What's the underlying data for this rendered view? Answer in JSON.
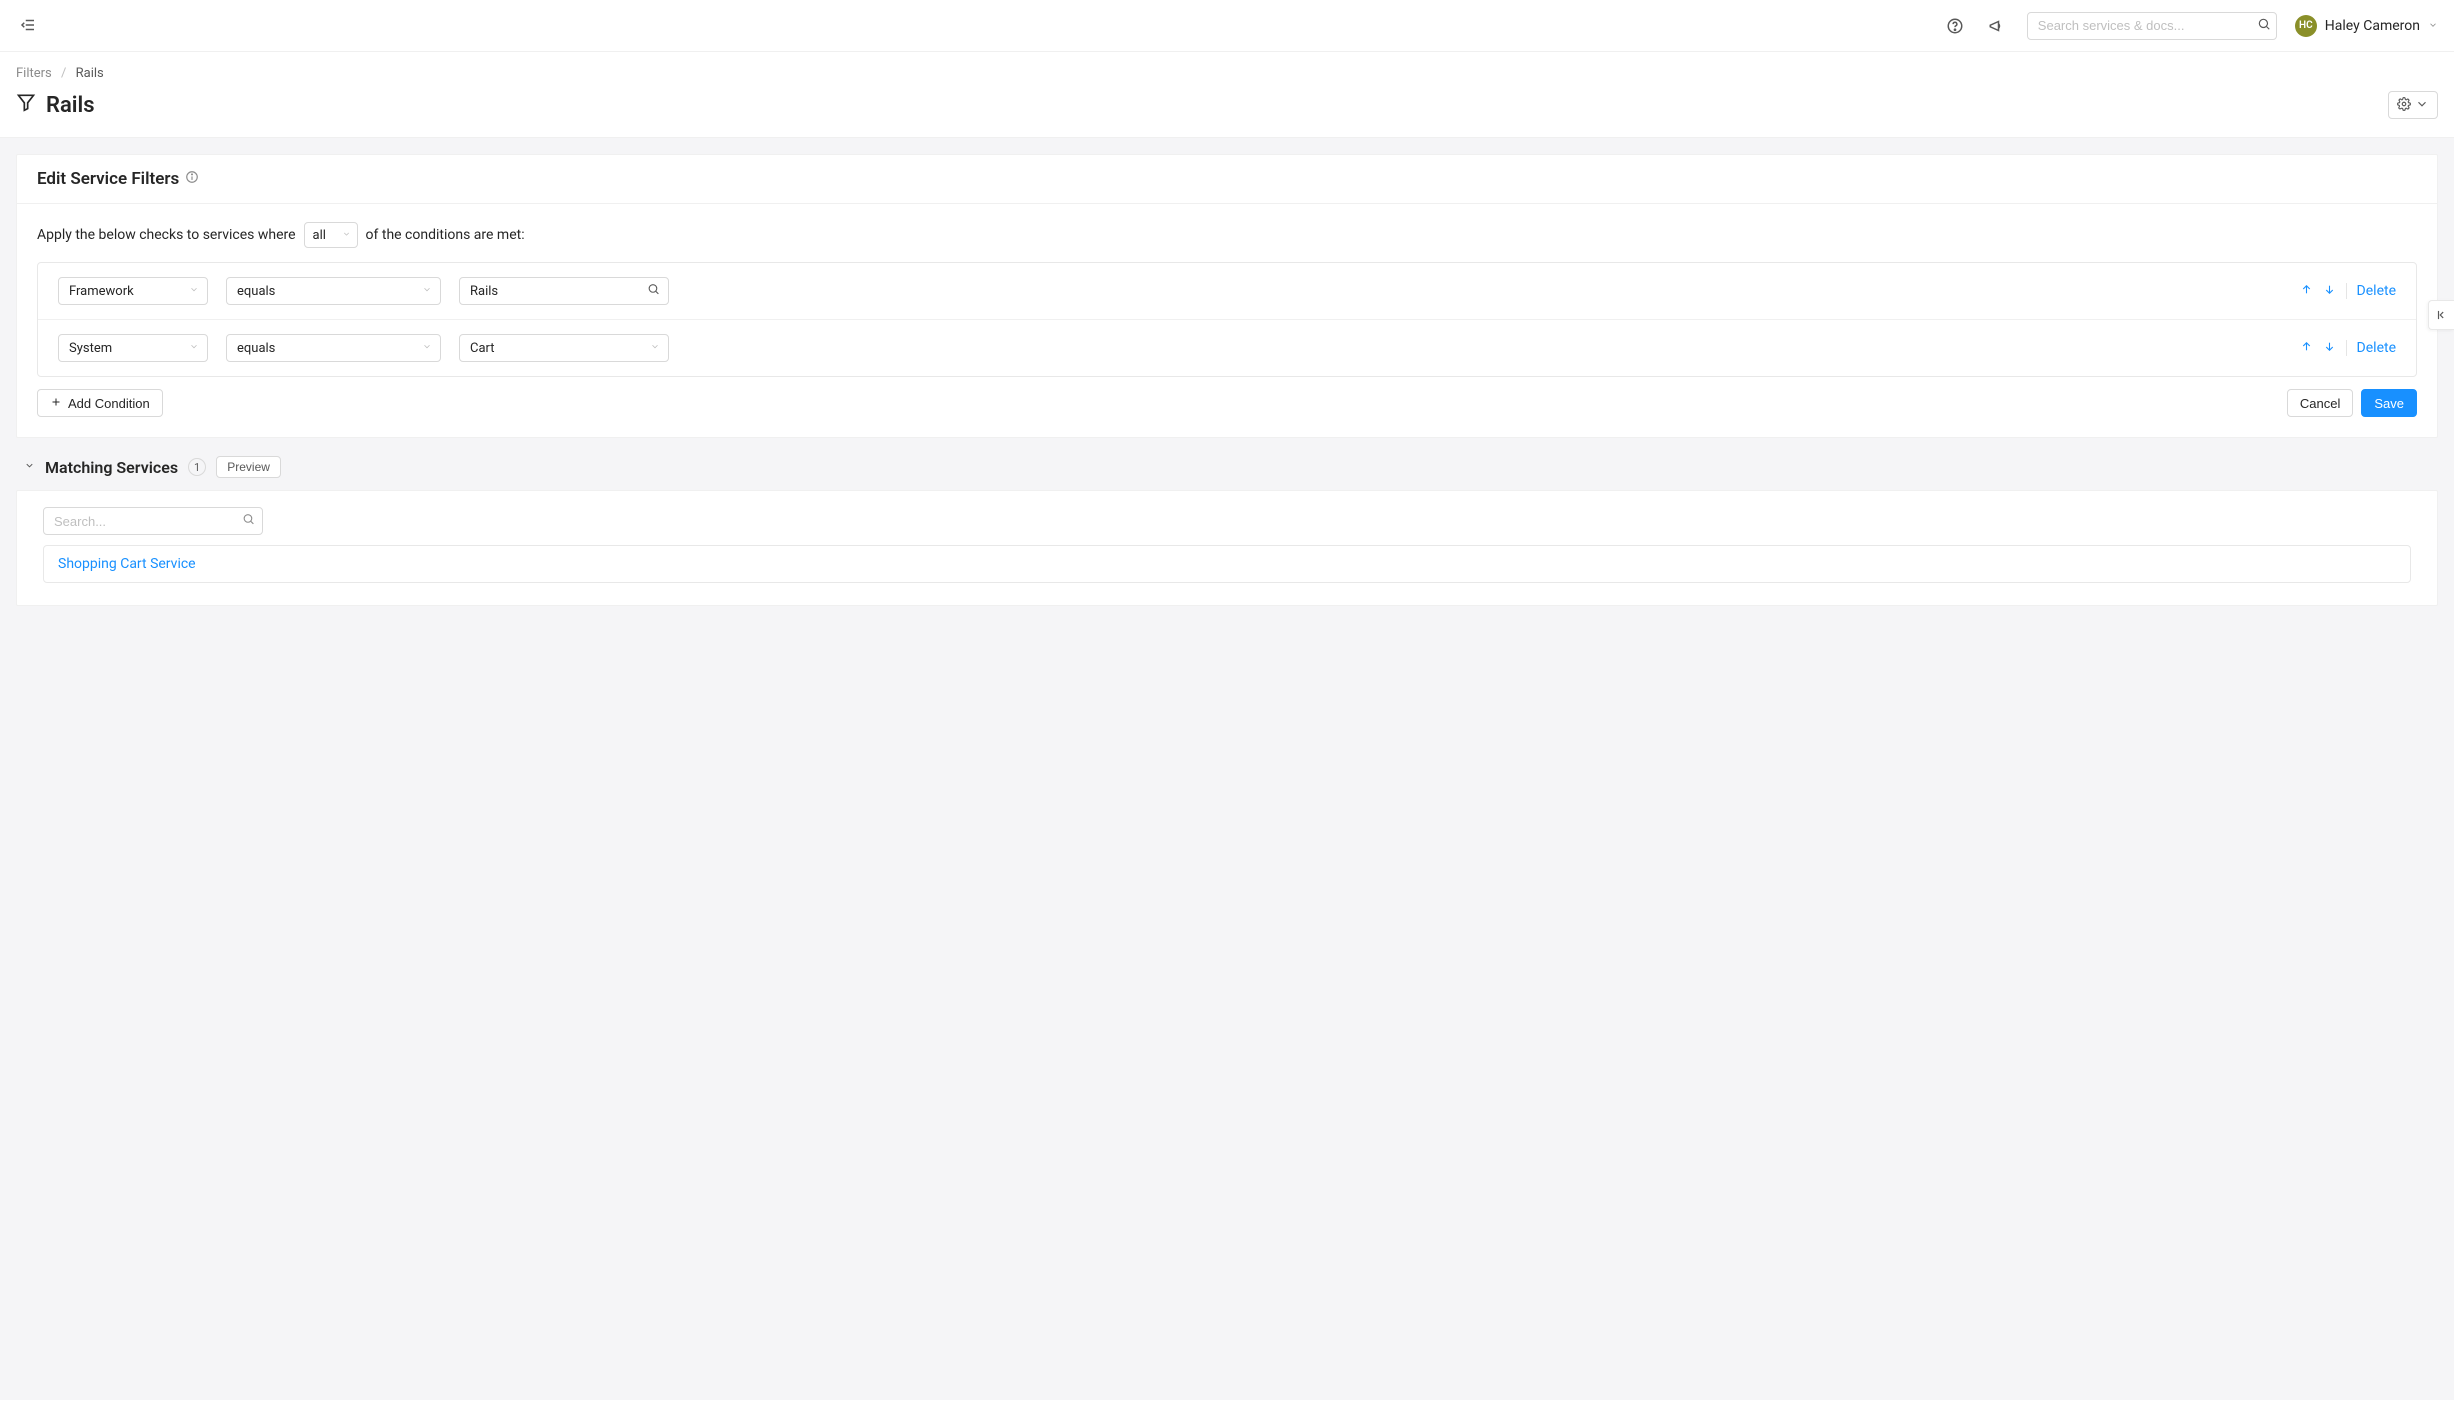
{
  "topbar": {
    "search_placeholder": "Search services & docs...",
    "user_initials": "HC",
    "user_name": "Haley Cameron"
  },
  "breadcrumb": {
    "root": "Filters",
    "current": "Rails"
  },
  "page_title": "Rails",
  "edit_card": {
    "title": "Edit Service Filters",
    "apply_prefix": "Apply the below checks to services where",
    "apply_mode": "all",
    "apply_suffix": "of the conditions are met:",
    "add_condition_label": "Add Condition",
    "cancel_label": "Cancel",
    "save_label": "Save",
    "delete_label": "Delete",
    "conditions": [
      {
        "key": "Framework",
        "op": "equals",
        "value": "Rails",
        "value_kind": "search"
      },
      {
        "key": "System",
        "op": "equals",
        "value": "Cart",
        "value_kind": "select"
      }
    ]
  },
  "matching": {
    "title": "Matching Services",
    "count": "1",
    "preview_label": "Preview",
    "search_placeholder": "Search...",
    "results": [
      {
        "name": "Shopping Cart Service"
      }
    ]
  }
}
